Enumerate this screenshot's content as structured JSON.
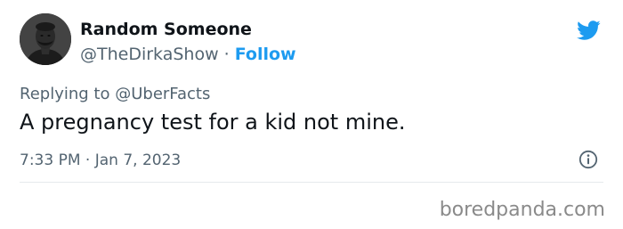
{
  "author": {
    "display_name": "Random Someone",
    "handle": "@TheDirkaShow",
    "separator": "·",
    "follow_label": "Follow"
  },
  "reply": {
    "prefix": "Replying to",
    "target": "@UberFacts"
  },
  "tweet": {
    "text": "A pregnancy test for a kid not mine.",
    "timestamp": "7:33 PM · Jan 7, 2023"
  },
  "icons": {
    "brand": "twitter-bird-icon",
    "info": "info-icon"
  },
  "colors": {
    "accent": "#1d9bf0",
    "text": "#0f1419",
    "muted": "#536471",
    "watermark": "#8a8a8a"
  },
  "watermark": "boredpanda.com"
}
